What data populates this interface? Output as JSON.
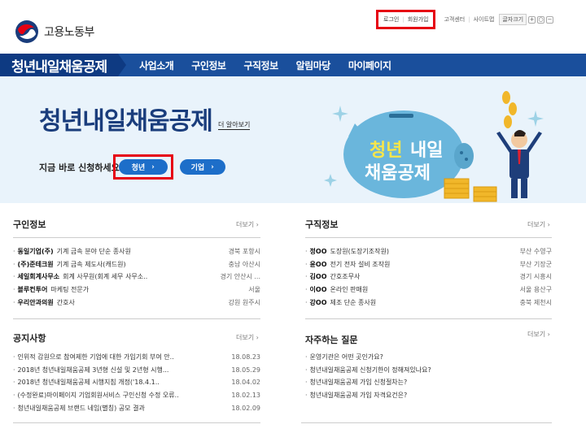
{
  "header": {
    "logo_text": "고용노동부",
    "login": "로그인",
    "signup": "회원가입",
    "customer_center": "고객센터",
    "sitemap": "사이트맵",
    "font_size": "글자크기"
  },
  "nav": {
    "brand": "청년내일채움공제",
    "items": [
      "사업소개",
      "구인정보",
      "구직정보",
      "알림마당",
      "마이페이지"
    ]
  },
  "hero": {
    "title": "청년내일채움공제",
    "more": "더 알아보기",
    "apply_label": "지금 바로 신청하세요",
    "youth_button": "청년",
    "company_button": "기업",
    "pig_line1a": "청년",
    "pig_line1b": "내일",
    "pig_line2": "채움공제"
  },
  "job_offers": {
    "title": "구인정보",
    "more": "더보기",
    "items": [
      {
        "company": "동일기업(주)",
        "desc": "기계 금속 분야 단순 종사원",
        "region": "경북 포항시"
      },
      {
        "company": "(주)준테크원",
        "desc": "기계 금속 제도사(캐드원)",
        "region": "충남 아산시"
      },
      {
        "company": "세일회계사무소",
        "desc": "회계 사무원(회계 세무 사무소..",
        "region": "경기 안산시 ..."
      },
      {
        "company": "블루컨투어",
        "desc": "마케팅 전문가",
        "region": "서울"
      },
      {
        "company": "우리안과의원",
        "desc": "간호사",
        "region": "강원 원주시"
      }
    ]
  },
  "job_seekers": {
    "title": "구직정보",
    "more": "더보기",
    "items": [
      {
        "name": "정OO",
        "desc": "도장원(도장기조작원)",
        "region": "부산 수영구"
      },
      {
        "name": "윤OO",
        "desc": "전기 전자 설비 조작원",
        "region": "부산 기장군"
      },
      {
        "name": "김OO",
        "desc": "간호조무사",
        "region": "경기 시흥시"
      },
      {
        "name": "이OO",
        "desc": "온라인 판매원",
        "region": "서울 용산구"
      },
      {
        "name": "강OO",
        "desc": "제조 단순 종사원",
        "region": "충북 제천시"
      }
    ]
  },
  "notices": {
    "title": "공지사항",
    "more": "더보기",
    "items": [
      {
        "text": "인위적 감원으로 참여제한 기업에 대한 가입기회 부여 안..",
        "date": "18.08.23"
      },
      {
        "text": "2018년 청년내일채움공제 3년형 신설 및 2년형 시행...",
        "date": "18.05.29"
      },
      {
        "text": "2018년 청년내일채움공제 시행지침 개정('18.4.1..",
        "date": "18.04.02"
      },
      {
        "text": "(수정완료)마이페이지 기업회원서비스 구인신청 수정 오류..",
        "date": "18.02.13"
      },
      {
        "text": "청년내일채움공제 브랜드 네임(별칭) 공모 결과",
        "date": "18.02.09"
      }
    ]
  },
  "faq": {
    "title": "자주하는 질문",
    "more": "더보기",
    "items": [
      "운영기관은 어떤 곳인가요?",
      "청년내일채움공제 신청기한이 정해져있나요?",
      "청년내일채움공제 가입 신청절차는?",
      "청년내일채움공제 가입 자격요건은?"
    ]
  }
}
